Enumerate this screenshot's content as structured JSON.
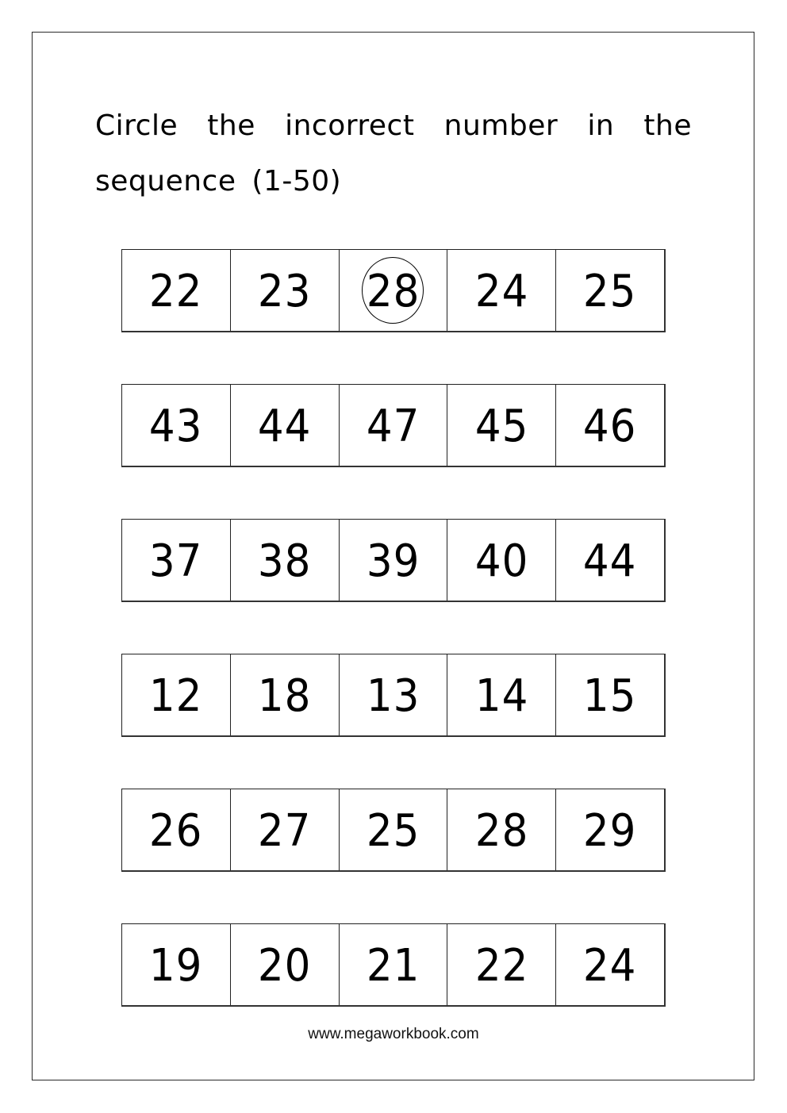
{
  "worksheet": {
    "instructions_line1": "Circle the incorrect number in the",
    "instructions_line2": "sequence (1-50)",
    "rows": [
      {
        "numbers": [
          "22",
          "23",
          "28",
          "24",
          "25"
        ],
        "circled_index": 2
      },
      {
        "numbers": [
          "43",
          "44",
          "47",
          "45",
          "46"
        ],
        "circled_index": null
      },
      {
        "numbers": [
          "37",
          "38",
          "39",
          "40",
          "44"
        ],
        "circled_index": null
      },
      {
        "numbers": [
          "12",
          "18",
          "13",
          "14",
          "15"
        ],
        "circled_index": null
      },
      {
        "numbers": [
          "26",
          "27",
          "25",
          "28",
          "29"
        ],
        "circled_index": null
      },
      {
        "numbers": [
          "19",
          "20",
          "21",
          "22",
          "24"
        ],
        "circled_index": null
      }
    ],
    "footer_url": "www.megaworkbook.com"
  }
}
